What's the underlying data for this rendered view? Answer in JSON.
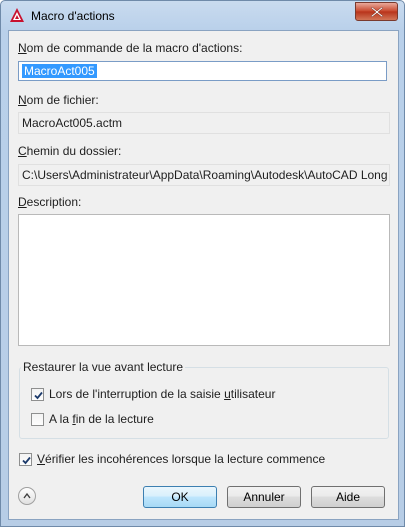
{
  "window": {
    "title": "Macro d'actions",
    "icon": "autocad-logo-icon",
    "close_icon": "close-icon"
  },
  "fields": {
    "command_name": {
      "label_pre": "",
      "label_ul": "N",
      "label_post": "om de commande de la macro d'actions:",
      "value": "MacroAct005"
    },
    "file_name": {
      "label_pre": "",
      "label_ul": "N",
      "label_post": "om de fichier:",
      "value": "MacroAct005.actm"
    },
    "folder_path": {
      "label_pre": "",
      "label_ul": "C",
      "label_post": "hemin du dossier:",
      "value": "C:\\Users\\Administrateur\\AppData\\Roaming\\Autodesk\\AutoCAD Long"
    },
    "description": {
      "label_pre": "",
      "label_ul": "D",
      "label_post": "escription:",
      "value": ""
    }
  },
  "restore_group": {
    "title": "Restaurer la vue avant lecture",
    "on_interrupt": {
      "pre": "Lors de l'interruption de la saisie ",
      "ul": "u",
      "post": "tilisateur",
      "checked": true
    },
    "on_end": {
      "pre": "A la ",
      "ul": "f",
      "post": "in de la lecture",
      "checked": false
    }
  },
  "verify": {
    "pre": "",
    "ul": "V",
    "post": "érifier les incohérences lorsque la lecture commence",
    "checked": true
  },
  "buttons": {
    "ok": "OK",
    "cancel": "Annuler",
    "help": "Aide"
  },
  "colors": {
    "selection": "#3399ff",
    "close_button": "#c7452a",
    "title_bg": "#b9d0ea"
  }
}
